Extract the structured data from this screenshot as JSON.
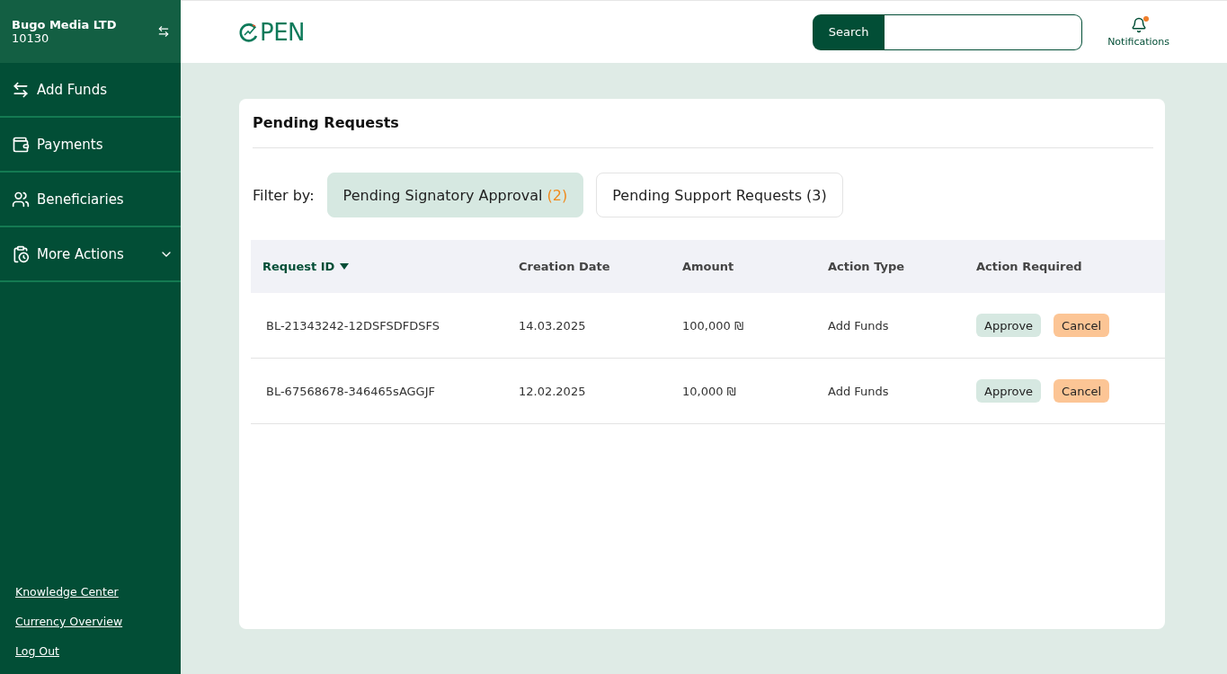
{
  "account": {
    "name": "Bugo Media LTD",
    "number": "10130"
  },
  "nav": [
    {
      "label": "Add Funds",
      "kind": "transfer",
      "expandable": false
    },
    {
      "label": "Payments",
      "kind": "wallet",
      "expandable": false
    },
    {
      "label": "Beneficiaries",
      "kind": "users",
      "expandable": false
    },
    {
      "label": "More Actions",
      "kind": "clipboard",
      "expandable": true
    }
  ],
  "footer_links": [
    "Knowledge Center",
    "Currency Overview",
    "Log Out"
  ],
  "logo": {
    "text": "PEN"
  },
  "search": {
    "button": "Search"
  },
  "notifications": {
    "label": "Notifications",
    "unread": true
  },
  "panel": {
    "title": "Pending Requests",
    "filter_label": "Filter by:",
    "filters": [
      {
        "label": "Pending Signatory Approval",
        "count": "(2)",
        "selected": true
      },
      {
        "label": "Pending Support Requests",
        "count": "(3)",
        "selected": false
      }
    ],
    "columns": [
      {
        "label": "Request ID",
        "sorted": true
      },
      {
        "label": "Creation Date",
        "sorted": false
      },
      {
        "label": "Amount",
        "sorted": false
      },
      {
        "label": "Action Type",
        "sorted": false
      },
      {
        "label": "Action Required",
        "sorted": false
      }
    ],
    "rows": [
      {
        "id": "BL-21343242-12DSFSDFDSFS",
        "date": "14.03.2025",
        "amount": "100,000 ₪",
        "type": "Add Funds",
        "actions": [
          {
            "label": "Approve",
            "kind": "approve"
          },
          {
            "label": "Cancel",
            "kind": "cancel"
          }
        ]
      },
      {
        "id": "BL-67568678-346465sAGGJF",
        "date": "12.02.2025",
        "amount": "10,000 ₪",
        "type": "Add Funds",
        "actions": [
          {
            "label": "Approve",
            "kind": "approve"
          },
          {
            "label": "Cancel",
            "kind": "cancel"
          }
        ]
      }
    ]
  }
}
